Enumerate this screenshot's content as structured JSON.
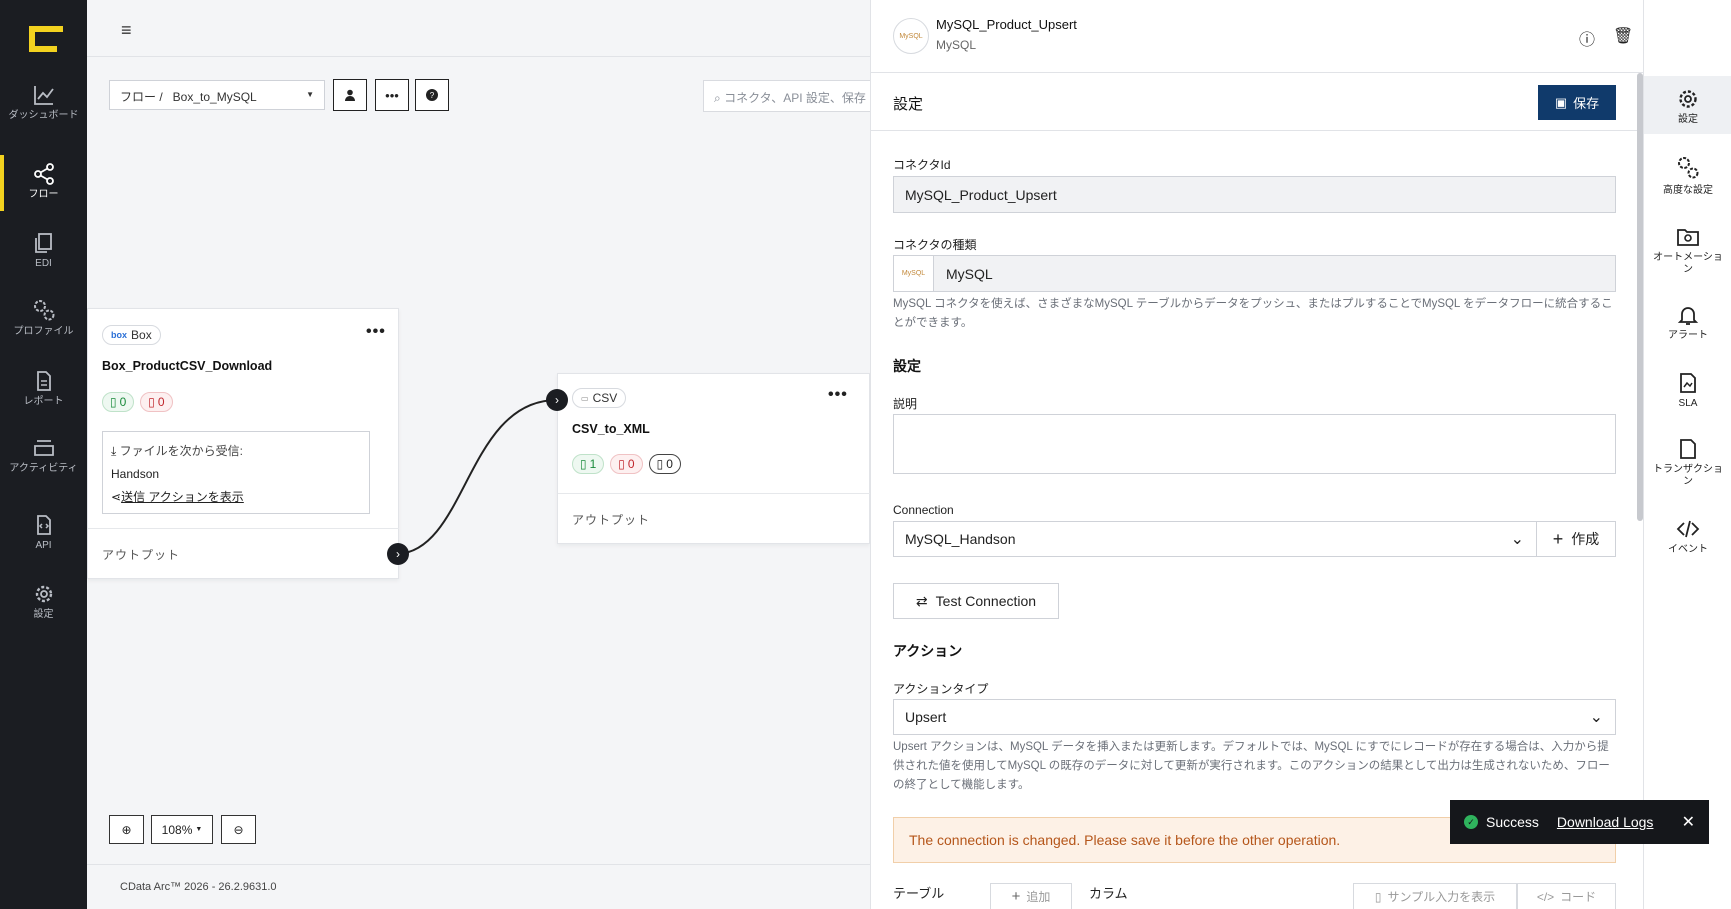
{
  "nav": {
    "items": [
      {
        "label": "ダッシュボード",
        "icon": "chart-line-icon"
      },
      {
        "label": "フロー",
        "icon": "share-nodes-icon"
      },
      {
        "label": "EDI",
        "icon": "files-icon"
      },
      {
        "label": "プロファイル",
        "icon": "gears-icon"
      },
      {
        "label": "レポート",
        "icon": "report-icon"
      },
      {
        "label": "アクティビティ",
        "icon": "layers-icon"
      },
      {
        "label": "API",
        "icon": "api-file-icon"
      },
      {
        "label": "設定",
        "icon": "gear-icon"
      }
    ]
  },
  "canvas": {
    "flow_select": "フロー /   Box_to_MySQL",
    "search_placeholder": "コネクタ、API 設定、保存",
    "zoom": "108%",
    "footer": "CData Arc™ 2026 - 26.2.9631.0",
    "nodes": {
      "box": {
        "type_label": "Box",
        "type_logo": "box",
        "title": "Box_ProductCSV_Download",
        "green": "0",
        "red": "0",
        "receive_label": "ファイルを次から受信:",
        "receive_from": "Handson",
        "send_action": "送信 アクションを表示",
        "output": "アウトプット"
      },
      "csv": {
        "type_label": "CSV",
        "title": "CSV_to_XML",
        "green": "1",
        "red": "0",
        "black": "0",
        "output": "アウトプット"
      }
    }
  },
  "panel": {
    "title": "MySQL_Product_Upsert",
    "subtitle": "MySQL",
    "section_title": "設定",
    "save_label": "保存",
    "connector_id_label": "コネクタId",
    "connector_id": "MySQL_Product_Upsert",
    "connector_type_label": "コネクタの種類",
    "connector_type": "MySQL",
    "connector_help": "MySQL コネクタを使えば、さまざまなMySQL テーブルからデータをプッシュ、またはプルすることでMySQL をデータフローに統合することができます。",
    "settings_heading": "設定",
    "description_label": "説明",
    "connection_label": "Connection",
    "connection_value": "MySQL_Handson",
    "create_label": "作成",
    "test_connection": "Test Connection",
    "action_heading": "アクション",
    "action_type_label": "アクションタイプ",
    "action_type_value": "Upsert",
    "action_help": "Upsert アクションは、MySQL データを挿入または更新します。デフォルトでは、MySQL にすでにレコードが存在する場合は、入力から提供された値を使用してMySQL の既存のデータに対して更新が実行されます。このアクションの結果として出力は生成されないため、フローの終了として機能します。",
    "warning": "The connection is changed. Please save it before the other operation.",
    "table_label": "テーブル",
    "add_label": "追加",
    "column_label": "カラム",
    "sample_label": "サンプル入力を表示",
    "code_label": "コード"
  },
  "rail": {
    "items": [
      {
        "label": "設定"
      },
      {
        "label": "高度な設定"
      },
      {
        "label": "オートメーション"
      },
      {
        "label": "アラート"
      },
      {
        "label": "SLA"
      },
      {
        "label": "トランザクション"
      },
      {
        "label": "イベント"
      }
    ]
  },
  "toast": {
    "status": "Success",
    "link": "Download Logs"
  },
  "colors": {
    "accent_yellow": "#f3d21f",
    "primary_button": "#103a6b",
    "success_green": "#2fb35d",
    "warning_text": "#b5561a"
  }
}
